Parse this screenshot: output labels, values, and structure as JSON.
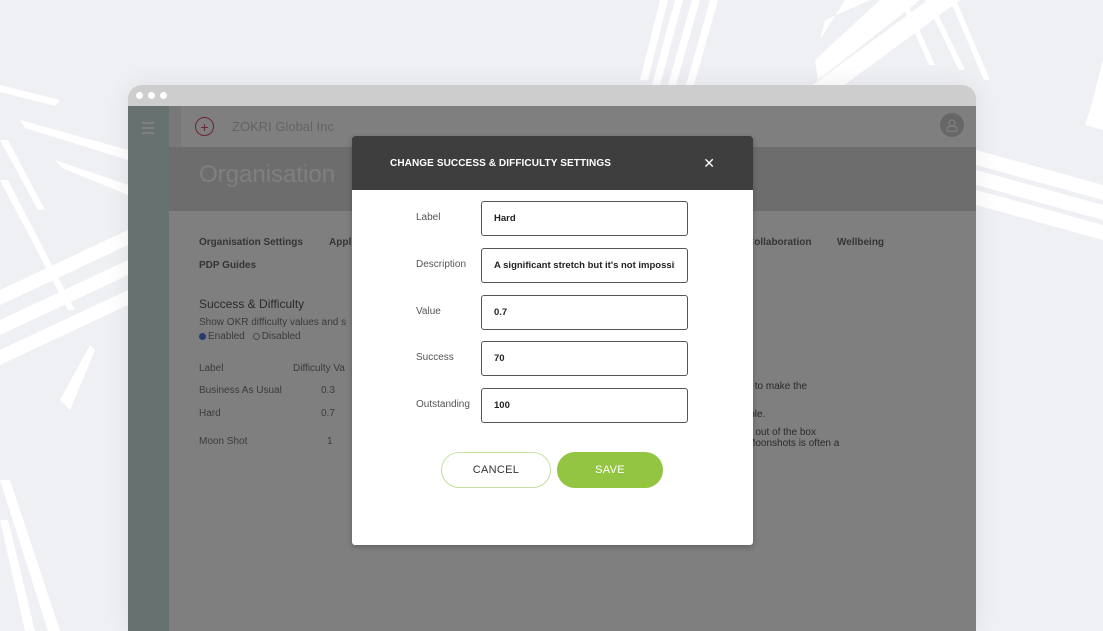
{
  "browser": {
    "dots": 3
  },
  "app": {
    "org_name": "ZOKRI Global Inc",
    "page_title": "Organisation",
    "tabs": [
      "Organisation Settings",
      "Appl",
      "Collaboration",
      "Wellbeing",
      "PDP Guides"
    ],
    "section": {
      "title": "Success & Difficulty",
      "description": "Show OKR difficulty values and s",
      "radio_enabled": "Enabled",
      "radio_disabled": "Disabled",
      "selected": "Enabled"
    },
    "table": {
      "headers": [
        "Label",
        "Difficulty Va"
      ],
      "rows": [
        [
          "Business As Usual",
          "0.3"
        ],
        [
          "Hard",
          "0.7"
        ],
        [
          "Moon Shot",
          "1"
        ]
      ]
    },
    "right_snippets": [
      "y to make the",
      "ible.",
      "e out of the box",
      "Moonshots is often a"
    ]
  },
  "modal": {
    "title": "CHANGE SUCCESS & DIFFICULTY SETTINGS",
    "close_icon": "close-icon",
    "fields": [
      {
        "label": "Label",
        "value": "Hard"
      },
      {
        "label": "Description",
        "value": "A significant stretch but it's not impossible"
      },
      {
        "label": "Value",
        "value": "0.7"
      },
      {
        "label": "Success",
        "value": "70"
      },
      {
        "label": "Outstanding",
        "value": "100"
      }
    ],
    "cancel_label": "CANCEL",
    "save_label": "SAVE"
  },
  "colors": {
    "accent_green": "#93c543",
    "modal_header": "#3e3e3e",
    "brand_pink": "#d9486a",
    "rail": "#cfe3e0"
  }
}
